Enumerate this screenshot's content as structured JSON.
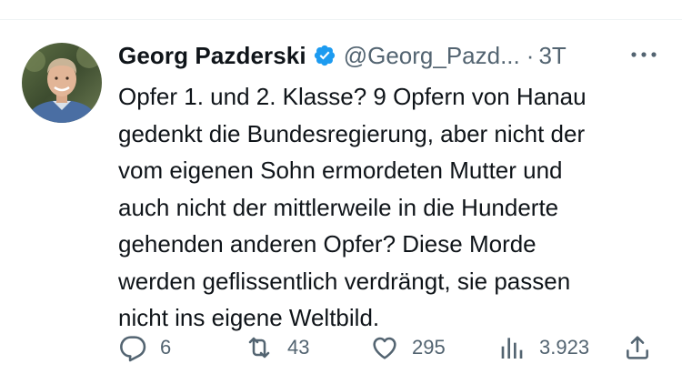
{
  "tweet": {
    "author": {
      "display_name": "Georg Pazderski",
      "handle": "@Georg_Pazd...",
      "verified": true
    },
    "separator": "·",
    "timestamp": "3T",
    "text": "Opfer 1. und 2. Klasse? 9 Opfern von Hanau\ngedenkt die Bundesregierung, aber nicht der\nvom eigenen Sohn ermordeten Mutter und\nauch nicht der mittlerweile in die Hunderte\ngehenden anderen Opfer? Diese Morde\nwerden geflissentlich verdrängt, sie passen\nnicht ins eigene Weltbild.",
    "actions": {
      "replies": "6",
      "retweets": "43",
      "likes": "295",
      "views": "3.923"
    }
  },
  "icons": {
    "verified": "verified-badge-icon",
    "more": "more-dots-icon",
    "reply": "reply-bubble-icon",
    "retweet": "retweet-icon",
    "like": "heart-icon",
    "views": "views-bar-chart-icon",
    "share": "share-icon"
  },
  "colors": {
    "text": "#0f1419",
    "secondary": "#536471",
    "verified": "#1d9bf0",
    "divider": "#eff3f4"
  }
}
